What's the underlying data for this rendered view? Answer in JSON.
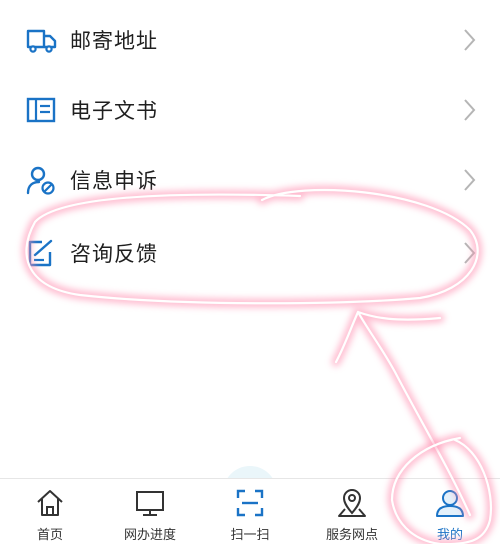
{
  "menu": {
    "items": [
      {
        "label": "邮寄地址",
        "icon": "mail-truck-icon"
      },
      {
        "label": "电子文书",
        "icon": "e-document-icon"
      },
      {
        "label": "信息申诉",
        "icon": "user-blocked-icon"
      },
      {
        "label": "咨询反馈",
        "icon": "edit-note-icon"
      }
    ]
  },
  "tabbar": {
    "tabs": [
      {
        "label": "首页",
        "icon": "home-icon"
      },
      {
        "label": "网办进度",
        "icon": "monitor-icon"
      },
      {
        "label": "扫一扫",
        "icon": "scan-icon"
      },
      {
        "label": "服务网点",
        "icon": "map-pin-icon"
      },
      {
        "label": "我的",
        "icon": "user-icon",
        "active": true
      }
    ]
  },
  "colors": {
    "icon_blue": "#1a73c6",
    "text": "#1f1f1f",
    "chevron": "#b5b5b5",
    "annotation_pink": "#ff5b86"
  }
}
